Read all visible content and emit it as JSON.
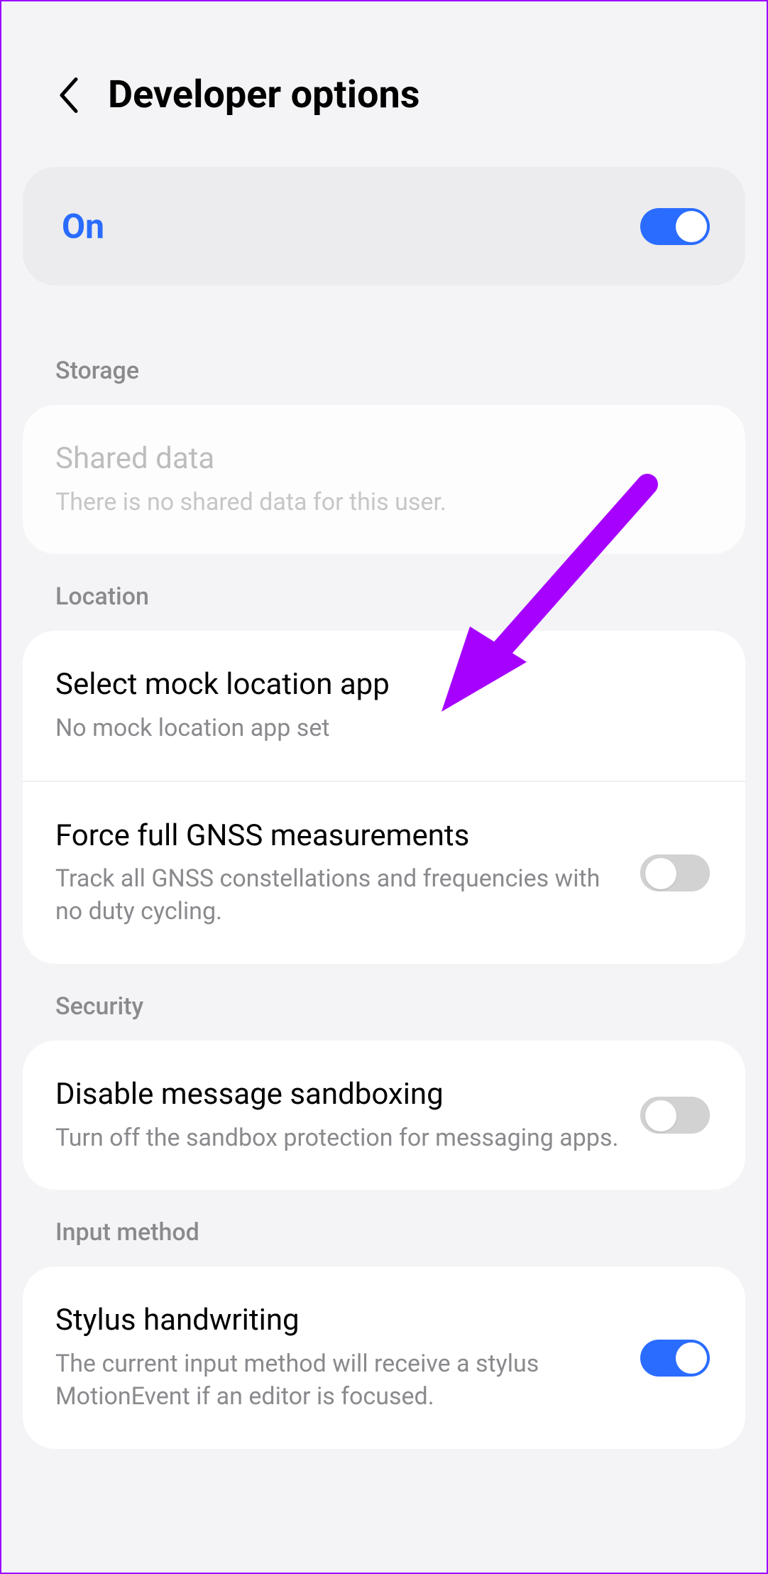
{
  "header": {
    "title": "Developer options"
  },
  "master": {
    "label": "On",
    "enabled": true
  },
  "sections": [
    {
      "header": "Storage",
      "rows": [
        {
          "title": "Shared data",
          "sub": "There is no shared data for this user.",
          "disabled": true,
          "toggle": null
        }
      ]
    },
    {
      "header": "Location",
      "rows": [
        {
          "title": "Select mock location app",
          "sub": "No mock location app set",
          "toggle": null
        },
        {
          "title": "Force full GNSS measurements",
          "sub": "Track all GNSS constellations and frequencies with no duty cycling.",
          "toggle": false
        }
      ]
    },
    {
      "header": "Security",
      "rows": [
        {
          "title": "Disable message sandboxing",
          "sub": "Turn off the sandbox protection for messaging apps.",
          "toggle": false
        }
      ]
    },
    {
      "header": "Input method",
      "rows": [
        {
          "title": "Stylus handwriting",
          "sub": "The current input method will receive a stylus MotionEvent if an editor is focused.",
          "toggle": true
        }
      ]
    }
  ],
  "annotation": {
    "points_to": "select-mock-location-app",
    "color": "#a600ff"
  }
}
